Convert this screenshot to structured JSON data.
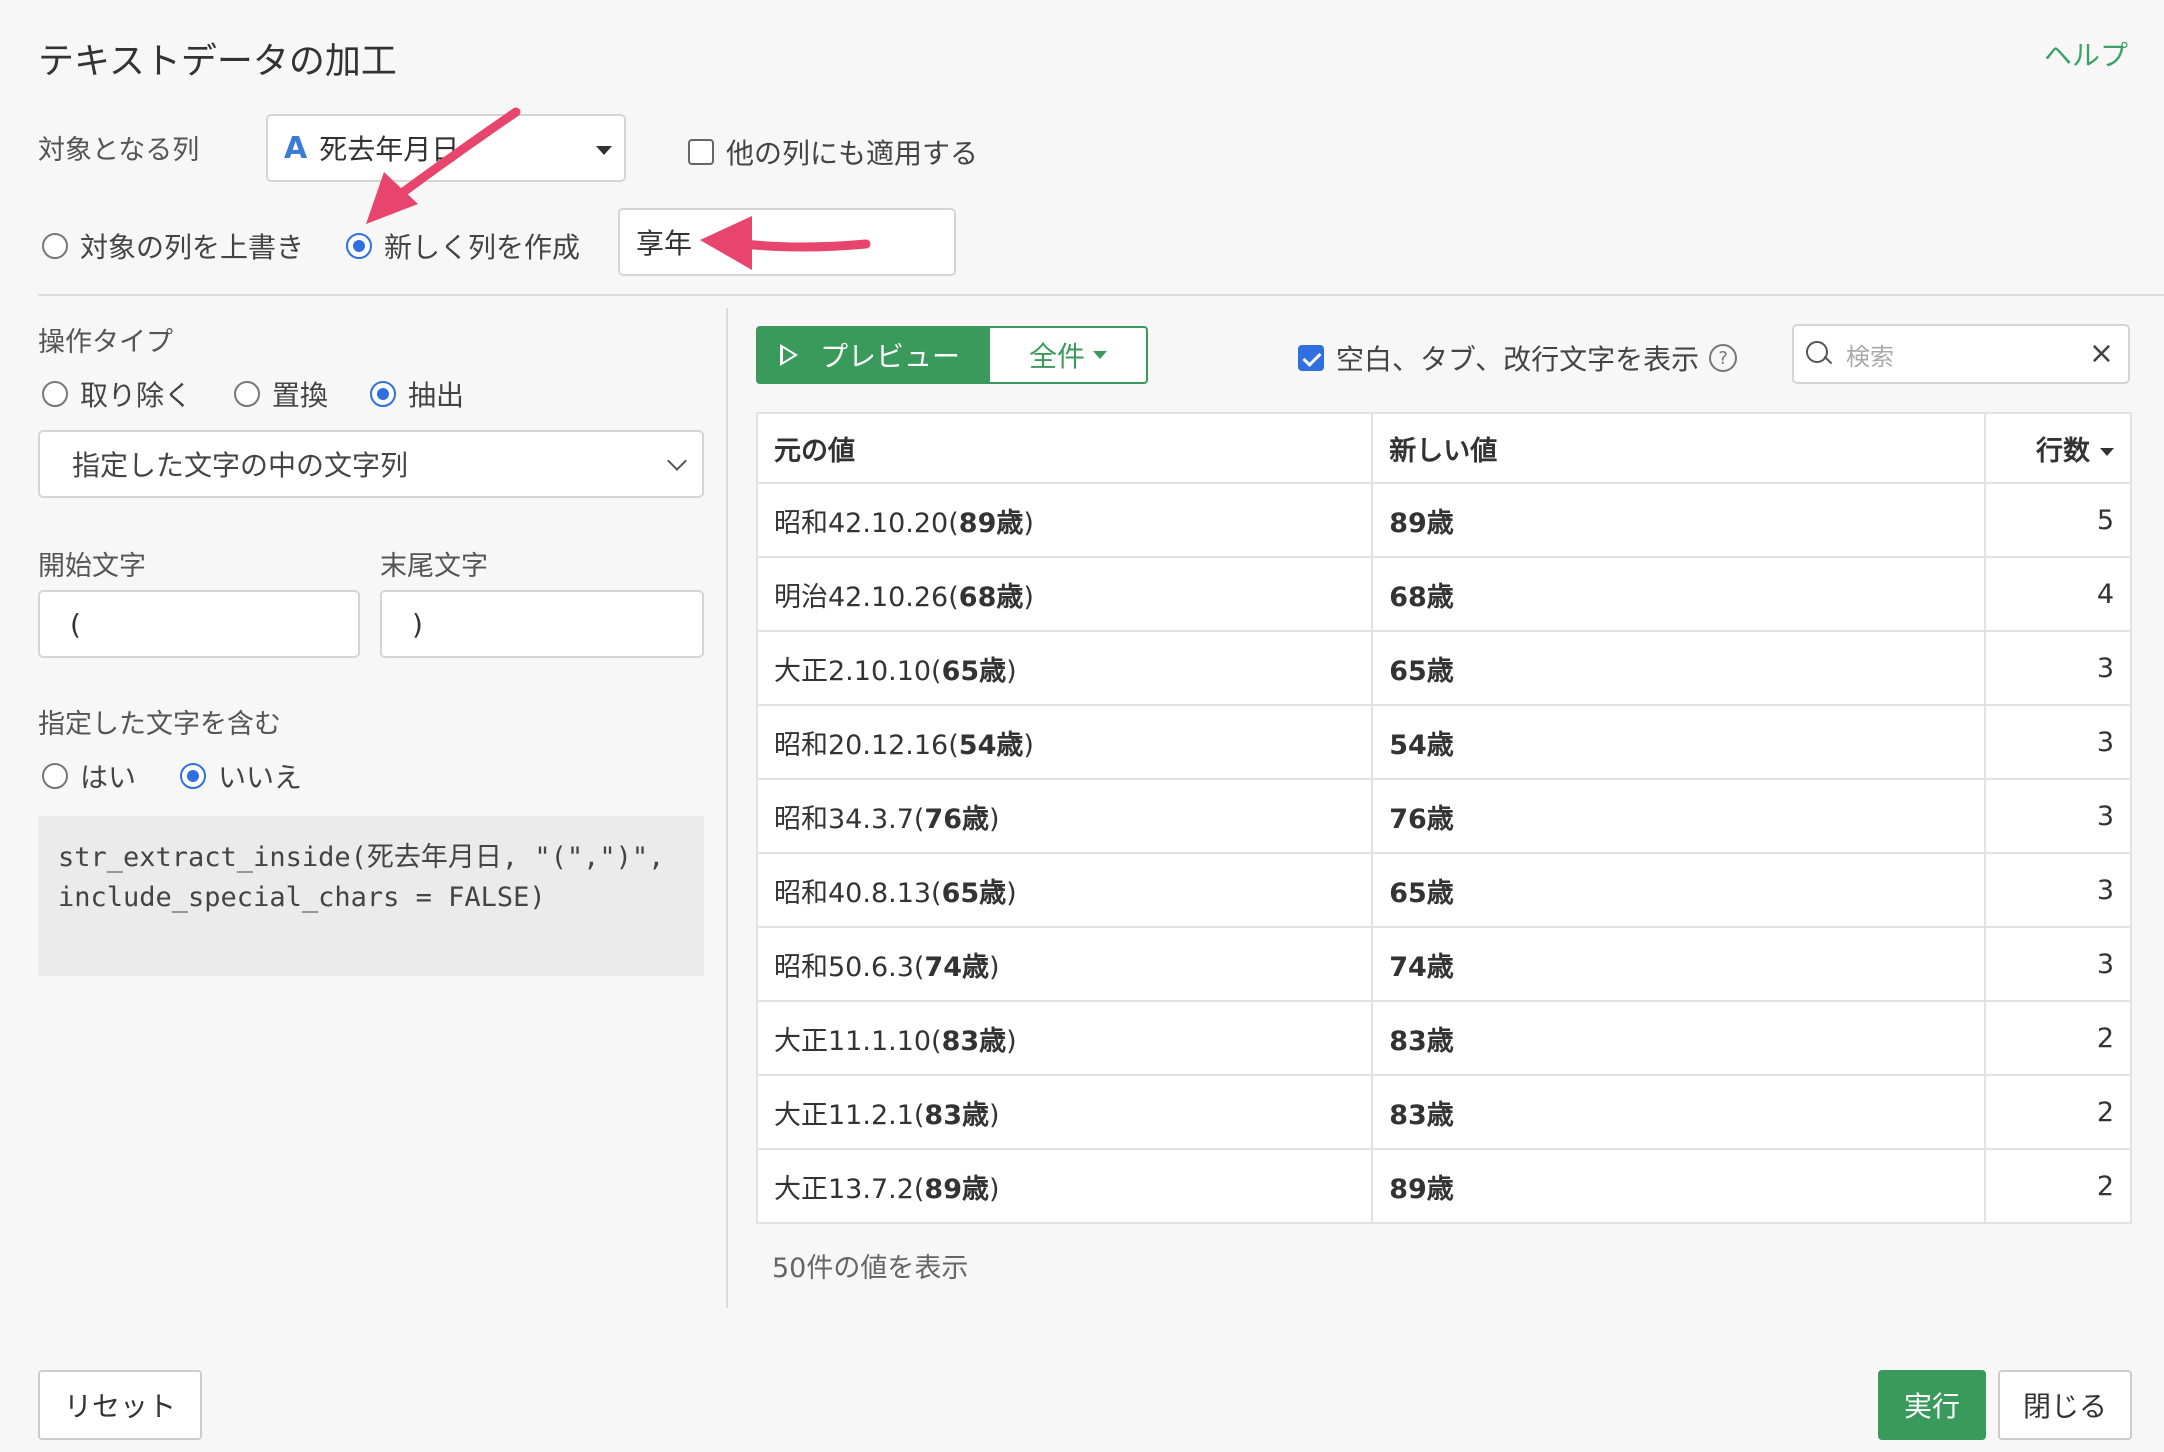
{
  "dialog": {
    "title": "テキストデータの加工",
    "help_link": "ヘルプ"
  },
  "target": {
    "label": "対象となる列",
    "column_type_icon": "A",
    "column_value": "死去年月日",
    "apply_other_label": "他の列にも適用する",
    "apply_other_checked": false
  },
  "output_mode": {
    "overwrite_label": "対象の列を上書き",
    "new_column_label": "新しく列を作成",
    "selected": "new_column",
    "new_column_name": "享年"
  },
  "operation": {
    "label": "操作タイプ",
    "options": [
      "取り除く",
      "置換",
      "抽出"
    ],
    "selected": "抽出",
    "method": "指定した文字の中の文字列",
    "start_label": "開始文字",
    "start_value": "(",
    "end_label": "末尾文字",
    "end_value": ")",
    "include_label": "指定した文字を含む",
    "include_yes": "はい",
    "include_no": "いいえ",
    "include_selected": "いいえ",
    "code": "str_extract_inside(死去年月日, \"(\",\")\", include_special_chars = FALSE)"
  },
  "preview": {
    "preview_button": "プレビュー",
    "all_button": "全件",
    "show_whitespace_label": "空白、タブ、改行文字を表示",
    "show_whitespace_checked": true,
    "search_placeholder": "検索",
    "columns": [
      "元の値",
      "新しい値",
      "行数"
    ],
    "rows": [
      {
        "orig_prefix": "昭和42.10.20(",
        "orig_match": "89歳",
        "orig_suffix": ")",
        "new": "89歳",
        "count": "5"
      },
      {
        "orig_prefix": "明治42.10.26(",
        "orig_match": "68歳",
        "orig_suffix": ")",
        "new": "68歳",
        "count": "4"
      },
      {
        "orig_prefix": "大正2.10.10(",
        "orig_match": "65歳",
        "orig_suffix": ")",
        "new": "65歳",
        "count": "3"
      },
      {
        "orig_prefix": "昭和20.12.16(",
        "orig_match": "54歳",
        "orig_suffix": ")",
        "new": "54歳",
        "count": "3"
      },
      {
        "orig_prefix": "昭和34.3.7(",
        "orig_match": "76歳",
        "orig_suffix": ")",
        "new": "76歳",
        "count": "3"
      },
      {
        "orig_prefix": "昭和40.8.13(",
        "orig_match": "65歳",
        "orig_suffix": ")",
        "new": "65歳",
        "count": "3"
      },
      {
        "orig_prefix": "昭和50.6.3(",
        "orig_match": "74歳",
        "orig_suffix": ")",
        "new": "74歳",
        "count": "3"
      },
      {
        "orig_prefix": "大正11.1.10(",
        "orig_match": "83歳",
        "orig_suffix": ")",
        "new": "83歳",
        "count": "2"
      },
      {
        "orig_prefix": "大正11.2.1(",
        "orig_match": "83歳",
        "orig_suffix": ")",
        "new": "83歳",
        "count": "2"
      },
      {
        "orig_prefix": "大正13.7.2(",
        "orig_match": "89歳",
        "orig_suffix": ")",
        "new": "89歳",
        "count": "2"
      }
    ],
    "footer_note": "50件の値を表示"
  },
  "footer": {
    "reset": "リセット",
    "run": "実行",
    "close": "閉じる"
  },
  "colors": {
    "accent_green": "#3a9a5c",
    "radio_blue": "#2f6fe0",
    "annotation_arrow": "#e8456e"
  }
}
